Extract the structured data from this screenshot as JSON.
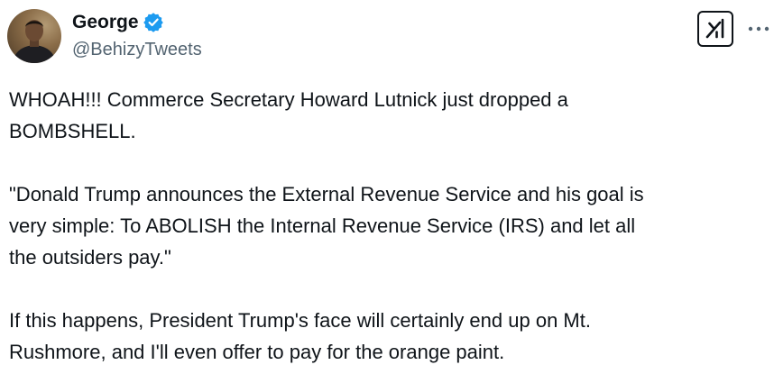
{
  "author": {
    "display_name": "George",
    "handle": "@BehizyTweets",
    "verified": true,
    "avatar_icon": "profile-photo"
  },
  "actions": {
    "grok_icon": "grok-icon",
    "more_icon": "more-options-icon"
  },
  "colors": {
    "verified_blue": "#1d9bf0",
    "text_primary": "#0f1419",
    "text_secondary": "#536471"
  },
  "tweet": {
    "paragraphs": [
      "WHOAH!!! Commerce Secretary Howard Lutnick just dropped a\nBOMBSHELL.",
      "\"Donald Trump announces the External Revenue Service and his goal is\nvery simple: To ABOLISH the Internal Revenue Service (IRS) and let all\nthe outsiders pay.\"",
      "If this happens, President Trump's face will certainly end up on Mt.\nRushmore, and I'll even offer to pay for the orange paint."
    ]
  }
}
